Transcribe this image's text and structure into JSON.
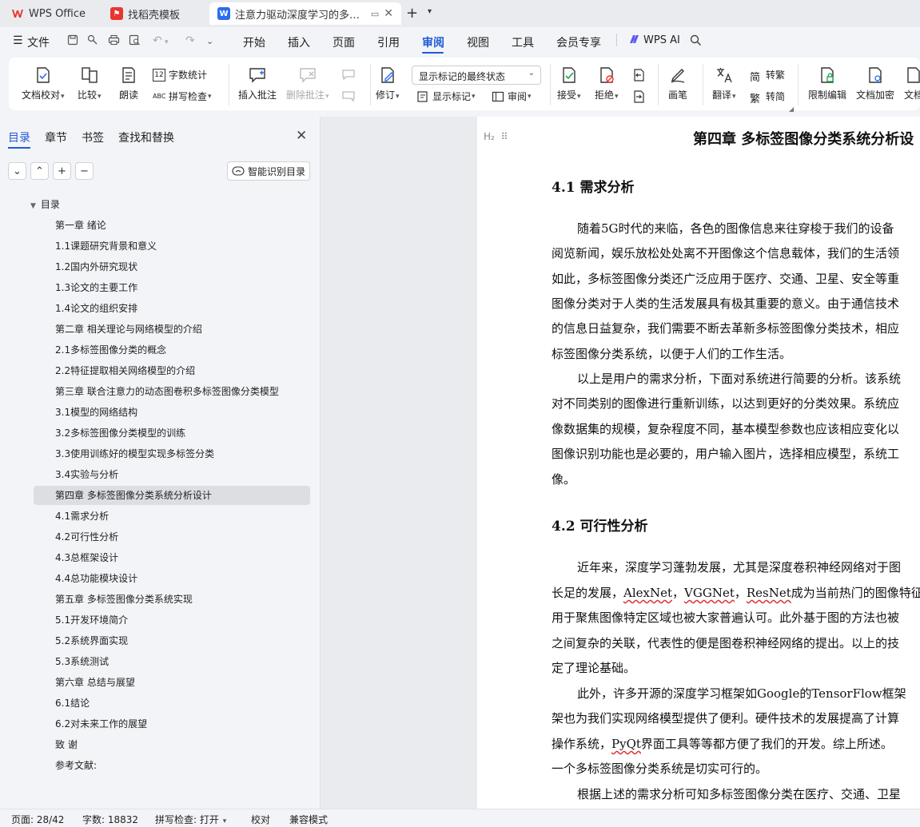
{
  "tabs": {
    "wps": "WPS Office",
    "template": "找稻壳模板",
    "document": "注意力驱动深度学习的多标签"
  },
  "menu": {
    "file": "文件",
    "items": [
      "开始",
      "插入",
      "页面",
      "引用",
      "审阅",
      "视图",
      "工具",
      "会员专享"
    ],
    "active": "审阅",
    "ai": "WPS AI"
  },
  "ribbon": {
    "doc_proof": "文档校对",
    "compare": "比较",
    "read_aloud": "朗读",
    "word_count": "字数统计",
    "spell_check": "拼写检查",
    "insert_comment": "插入批注",
    "delete_comment": "删除批注",
    "revise": "修订",
    "markup_state": "显示标记的最终状态",
    "show_markup": "显示标记",
    "review": "审阅",
    "accept": "接受",
    "reject": "拒绝",
    "ink": "画笔",
    "translate": "翻译",
    "to_traditional": "转繁",
    "to_simplified": "转简",
    "restrict_edit": "限制编辑",
    "doc_encrypt": "文档加密",
    "doc_truncated": "文档"
  },
  "nav": {
    "tabs": [
      "目录",
      "章节",
      "书签",
      "查找和替换"
    ],
    "smart_toc": "智能识别目录",
    "root": "目录",
    "items": [
      "第一章 绪论",
      "1.1课题研究背景和意义",
      "1.2国内外研究现状",
      "1.3论文的主要工作",
      "1.4论文的组织安排",
      "第二章 相关理论与网络模型的介绍",
      "2.1多标签图像分类的概念",
      "2.2特征提取相关网络模型的介绍",
      "第三章 联合注意力的动态图卷积多标签图像分类模型",
      "3.1模型的网络结构",
      "3.2多标签图像分类模型的训练",
      "3.3使用训练好的模型实现多标签分类",
      "3.4实验与分析",
      "第四章 多标签图像分类系统分析设计",
      "4.1需求分析",
      "4.2可行性分析",
      "4.3总框架设计",
      "4.4总功能模块设计",
      "第五章 多标签图像分类系统实现",
      "5.1开发环境简介",
      "5.2系统界面实现",
      "5.3系统测试",
      "第六章 总结与展望",
      "6.1结论",
      "6.2对未来工作的展望",
      "致 谢",
      "参考文献:"
    ],
    "selected_index": 13
  },
  "doc": {
    "style_mark": "H₂",
    "chapter_title": "第四章 多标签图像分类系统分析设",
    "sec1": "4.1  需求分析",
    "para1": [
      "随着5G时代的来临，各色的图像信息来往穿梭于我们的设备",
      "阅览新闻，娱乐放松处处离不开图像这个信息载体，我们的生活领",
      "如此，多标签图像分类还广泛应用于医疗、交通、卫星、安全等重",
      "图像分类对于人类的生活发展具有极其重要的意义。由于通信技术",
      "的信息日益复杂，我们需要不断去革新多标签图像分类技术，相应",
      "标签图像分类系统，以便于人们的工作生活。"
    ],
    "para2": [
      "以上是用户的需求分析，下面对系统进行简要的分析。该系统",
      "对不同类别的图像进行重新训练，以达到更好的分类效果。系统应",
      "像数据集的规模，复杂程度不同，基本模型参数也应该相应变化以",
      "图像识别功能也是必要的，用户输入图片，选择相应模型，系统工",
      "像。"
    ],
    "sec2": "4.2  可行性分析",
    "para3": {
      "l1": "近年来，深度学习蓬勃发展，尤其是深度卷积神经网络对于图",
      "l2_a": "长足的发展，",
      "alexnet": "AlexNet",
      "sep1": "，",
      "vggnet": "VGGNet",
      "sep2": "，",
      "resnet": "ResNet",
      "l2_b": "成为当前热门的图像特征",
      "l3": "用于聚焦图像特定区域也被大家普遍认可。此外基于图的方法也被",
      "l4": "之间复杂的关联，代表性的便是图卷积神经网络的提出。以上的技",
      "l5": "定了理论基础。"
    },
    "para4": {
      "l1": "此外，许多开源的深度学习框架如Google的TensorFlow框架",
      "l2": "架也为我们实现网络模型提供了便利。硬件技术的发展提高了计算",
      "l3_a": "操作系统，",
      "pyqt": "PyQt",
      "l3_b": "界面工具等等都方便了我们的开发。综上所述。",
      "l4": "一个多标签图像分类系统是切实可行的。"
    },
    "para5": "根据上述的需求分析可知多标签图像分类在医疗、交通、卫星"
  },
  "status": {
    "page": "页面: 28/42",
    "words": "字数: 18832",
    "spell": "拼写检查: 打开",
    "proof": "校对",
    "compat": "兼容模式"
  },
  "colors": {
    "accent": "#1f5ad6",
    "wps_red": "#e8352e",
    "writer_blue": "#2b6cf0",
    "spell_wave": "#dd3333"
  }
}
